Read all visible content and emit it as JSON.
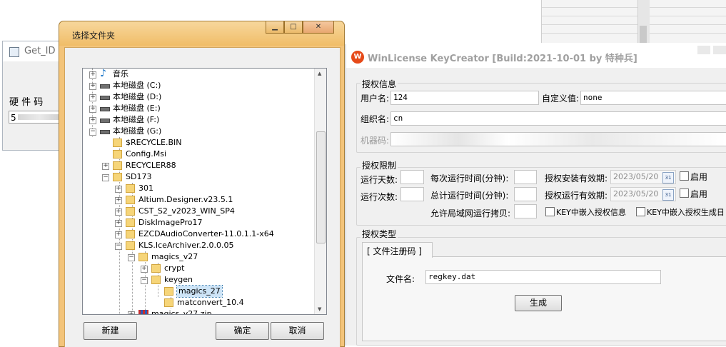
{
  "get_id_window": {
    "title": "Get_ID",
    "hardware_code_label": "硬 件 码",
    "hardware_code_value": "5"
  },
  "folder_dialog": {
    "title": "选择文件夹",
    "buttons": {
      "new": "新建",
      "ok": "确定",
      "cancel": "取消"
    },
    "tree": [
      {
        "label": "音乐",
        "level": 0,
        "icon": "music-icon",
        "expander": "+"
      },
      {
        "label": "本地磁盘 (C:)",
        "level": 0,
        "icon": "drive-icon",
        "expander": "+"
      },
      {
        "label": "本地磁盘 (D:)",
        "level": 0,
        "icon": "drive-icon",
        "expander": "+"
      },
      {
        "label": "本地磁盘 (E:)",
        "level": 0,
        "icon": "drive-icon",
        "expander": "+"
      },
      {
        "label": "本地磁盘 (F:)",
        "level": 0,
        "icon": "drive-icon",
        "expander": "+"
      },
      {
        "label": "本地磁盘 (G:)",
        "level": 0,
        "icon": "drive-icon",
        "expander": "-"
      },
      {
        "label": "$RECYCLE.BIN",
        "level": 1,
        "icon": "folder-icon",
        "expander": ""
      },
      {
        "label": "Config.Msi",
        "level": 1,
        "icon": "folder-icon",
        "expander": ""
      },
      {
        "label": "RECYCLER88",
        "level": 1,
        "icon": "folder-icon",
        "expander": "+"
      },
      {
        "label": "SD173",
        "level": 1,
        "icon": "folder-icon",
        "expander": "-"
      },
      {
        "label": "301",
        "level": 2,
        "icon": "folder-icon",
        "expander": "+"
      },
      {
        "label": "Altium.Designer.v23.5.1",
        "level": 2,
        "icon": "folder-icon",
        "expander": "+"
      },
      {
        "label": "CST_S2_v2023_WIN_SP4",
        "level": 2,
        "icon": "folder-icon",
        "expander": "+"
      },
      {
        "label": "DiskImagePro17",
        "level": 2,
        "icon": "folder-icon",
        "expander": "+"
      },
      {
        "label": "EZCDAudioConverter-11.0.1.1-x64",
        "level": 2,
        "icon": "folder-icon",
        "expander": "+"
      },
      {
        "label": "KLS.IceArchiver.2.0.0.05",
        "level": 2,
        "icon": "folder-icon",
        "expander": "-"
      },
      {
        "label": "magics_v27",
        "level": 3,
        "icon": "folder-icon",
        "expander": "-"
      },
      {
        "label": "crypt",
        "level": 4,
        "icon": "folder-icon",
        "expander": "+"
      },
      {
        "label": "keygen",
        "level": 4,
        "icon": "folder-icon",
        "expander": "-"
      },
      {
        "label": "magics_27",
        "level": 5,
        "icon": "folder-icon",
        "expander": "",
        "selected": true
      },
      {
        "label": "matconvert_10.4",
        "level": 5,
        "icon": "folder-icon",
        "expander": ""
      },
      {
        "label": "magics_v27.zip",
        "level": 3,
        "icon": "zip-icon",
        "expander": "+"
      }
    ]
  },
  "keycreator": {
    "title": "WinLicense KeyCreator  [Build:2021-10-01 by 特种兵]",
    "license_info": {
      "legend": "授权信息",
      "username_label": "用户名:",
      "username_value": "124",
      "custom_label": "自定义值:",
      "custom_value": "none",
      "org_label": "组织名:",
      "org_value": "cn",
      "machine_label": "机器码:"
    },
    "license_limits": {
      "legend": "授权限制",
      "run_days_label": "运行天数:",
      "run_count_label": "运行次数:",
      "per_run_label": "每次运行时间(分钟):",
      "total_run_label": "总计运行时间(分钟):",
      "lan_copies_label": "允许局域网运行拷贝:",
      "install_valid_label": "授权安装有效期:",
      "install_valid_date": "2023/05/20",
      "run_valid_label": "授权运行有效期:",
      "run_valid_date": "2023/05/20",
      "enable_label": "启用",
      "embed_info_label": "KEY中嵌入授权信息",
      "embed_gen_label": "KEY中嵌入授权生成日"
    },
    "license_type": {
      "legend": "授权类型",
      "tab_label": "[ 文件注册码 ]",
      "filename_label": "文件名:",
      "filename_value": "regkey.dat",
      "generate_button": "生成"
    }
  }
}
